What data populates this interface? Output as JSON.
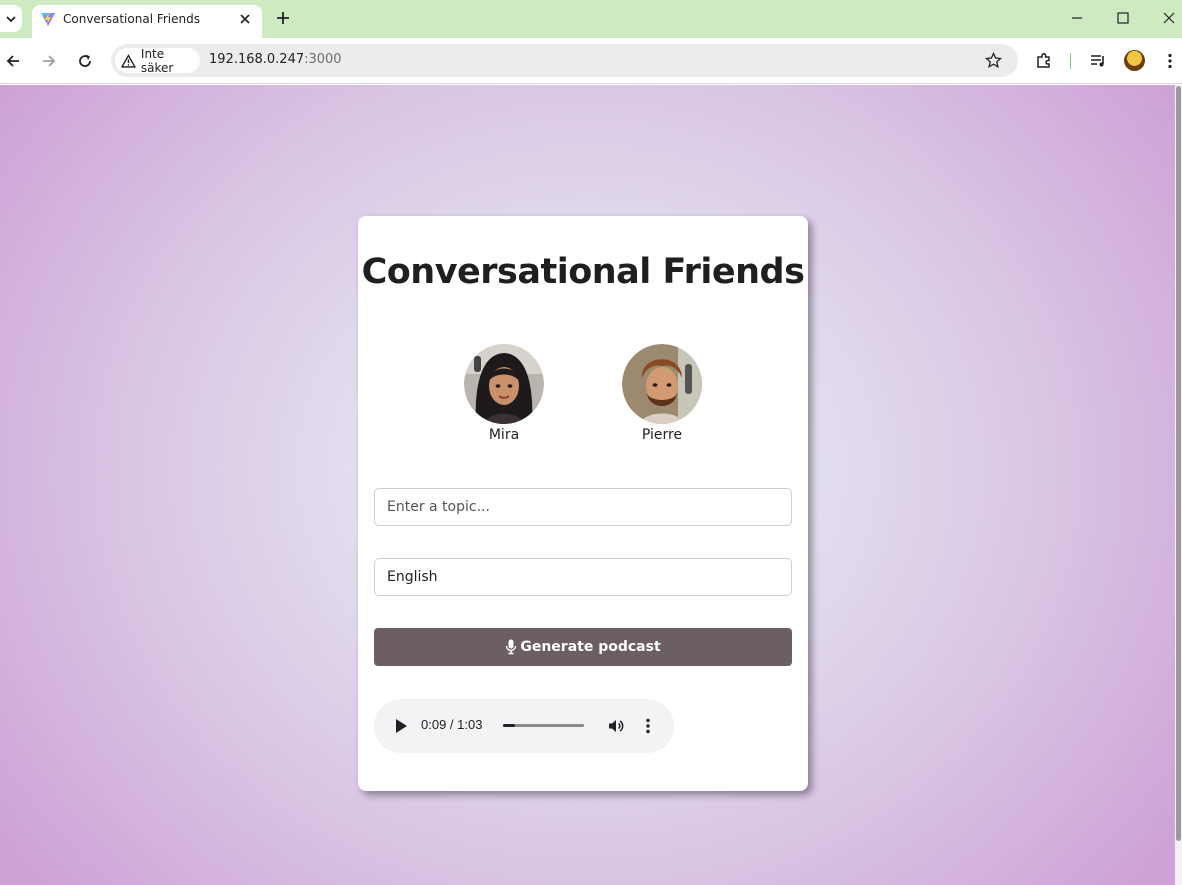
{
  "browser": {
    "tab_title": "Conversational Friends",
    "security_label": "Inte säker",
    "url_host": "192.168.0.247",
    "url_port": ":3000"
  },
  "page": {
    "title": "Conversational Friends",
    "hosts": [
      {
        "name": "Mira"
      },
      {
        "name": "Pierre"
      }
    ],
    "topic_placeholder": "Enter a topic...",
    "language_selected": "English",
    "generate_button_label": "Generate podcast",
    "audio": {
      "time_display": "0:09 / 1:03",
      "progress_fraction": 0.143
    }
  },
  "colors": {
    "tabbar_bg": "#cdeac0",
    "button_bg": "#6b5f63",
    "background_center": "#e4f7f5",
    "background_edge": "#cea2d6"
  }
}
